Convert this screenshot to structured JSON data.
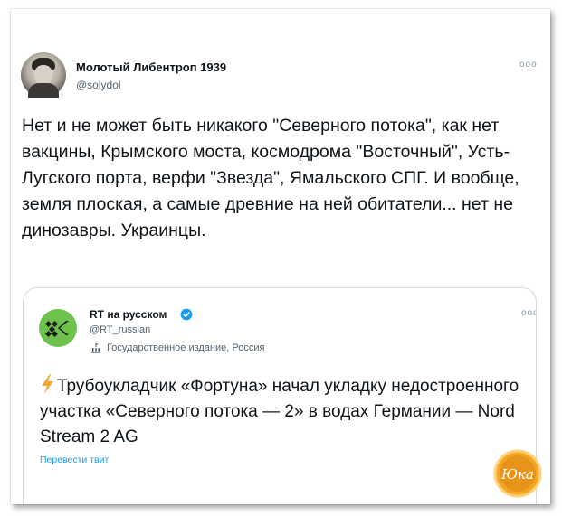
{
  "tweet": {
    "author_name": "Молотый Либентроп 1939",
    "author_handle": "@solydol",
    "more_icon": "ooo",
    "text": "Нет и не может быть никакого \"Северного потока\", как нет вакцины, Крымского моста, космодрома \"Восточный\", Усть-Лугского порта, верфи \"Звезда\", Ямальского СПГ. И вообще, земля плоская, а самые древние на ней обитатели... нет не динозавры. Украинцы."
  },
  "quoted_tweet": {
    "author_name": "RT на русском",
    "author_handle": "@RT_russian",
    "label": "Государственное издание, Россия",
    "more_icon": "ooo",
    "text": "Трубоукладчик «Фортуна» начал укладку недостроенного участка «Северного потока — 2» в водах Германии — Nord Stream 2 AG",
    "translate_link": "Перевести твит"
  },
  "watermark": {
    "text": "Юка",
    "color": "#e8a317"
  },
  "colors": {
    "rt_green": "#6cc24a",
    "verified_blue": "#1d9bf0",
    "link_blue": "#1d9bf0",
    "bolt_orange": "#f7a531"
  },
  "icons": [
    "avatar",
    "more-icon",
    "rt-logo",
    "verified-icon",
    "government-building-icon",
    "lightning-bolt-icon",
    "watermark-logo"
  ]
}
